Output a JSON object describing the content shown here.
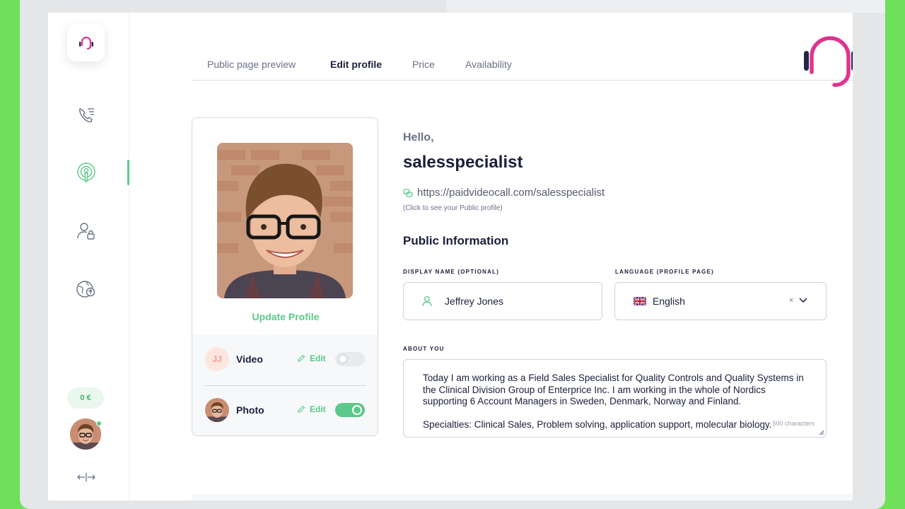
{
  "tabs": [
    {
      "label": "Public page preview",
      "active": false
    },
    {
      "label": "Edit profile",
      "active": true
    },
    {
      "label": "Price",
      "active": false
    },
    {
      "label": "Availability",
      "active": false
    }
  ],
  "sidebar": {
    "items": [
      {
        "icon": "phone-list-icon"
      },
      {
        "icon": "podcast-icon",
        "active": true
      },
      {
        "icon": "user-lock-icon"
      },
      {
        "icon": "globe-upload-icon"
      }
    ],
    "balance": "0 €",
    "collapse_icon": "collapse-arrows-icon"
  },
  "card": {
    "update_label": "Update Profile",
    "rows": [
      {
        "badge": "JJ",
        "label": "Video",
        "edit_label": "Edit",
        "enabled": false
      },
      {
        "label": "Photo",
        "edit_label": "Edit",
        "enabled": true
      }
    ]
  },
  "profile": {
    "greeting": "Hello,",
    "username": "salesspecialist",
    "url": "https://paidvideocall.com/salesspecialist",
    "url_hint": "(Click to see your Public profile)"
  },
  "public_info": {
    "title": "Public Information",
    "display_name_label": "DISPLAY NAME (OPTIONAL)",
    "display_name_value": "Jeffrey Jones",
    "language_label": "LANGUAGE (PROFILE PAGE)",
    "language_value": "English",
    "language_clear": "×",
    "about_label": "ABOUT YOU",
    "about_paragraph_1": "Today I am working as a Field Sales Specialist for Quality Controls and Quality Systems in the Clinical Division Group of Enterprice Inc. I am working in the whole of Nordics supporting 6 Account Managers in Sweden, Denmark, Norway and Finland.",
    "about_paragraph_2": "Specialties: Clinical Sales, Problem solving, application support, molecular biology.",
    "char_count": "500 characters"
  },
  "colors": {
    "accent_green": "#5cc98a",
    "text_dark": "#1b1f3b",
    "brand_pink": "#e0338f",
    "brand_navy": "#23284a"
  }
}
